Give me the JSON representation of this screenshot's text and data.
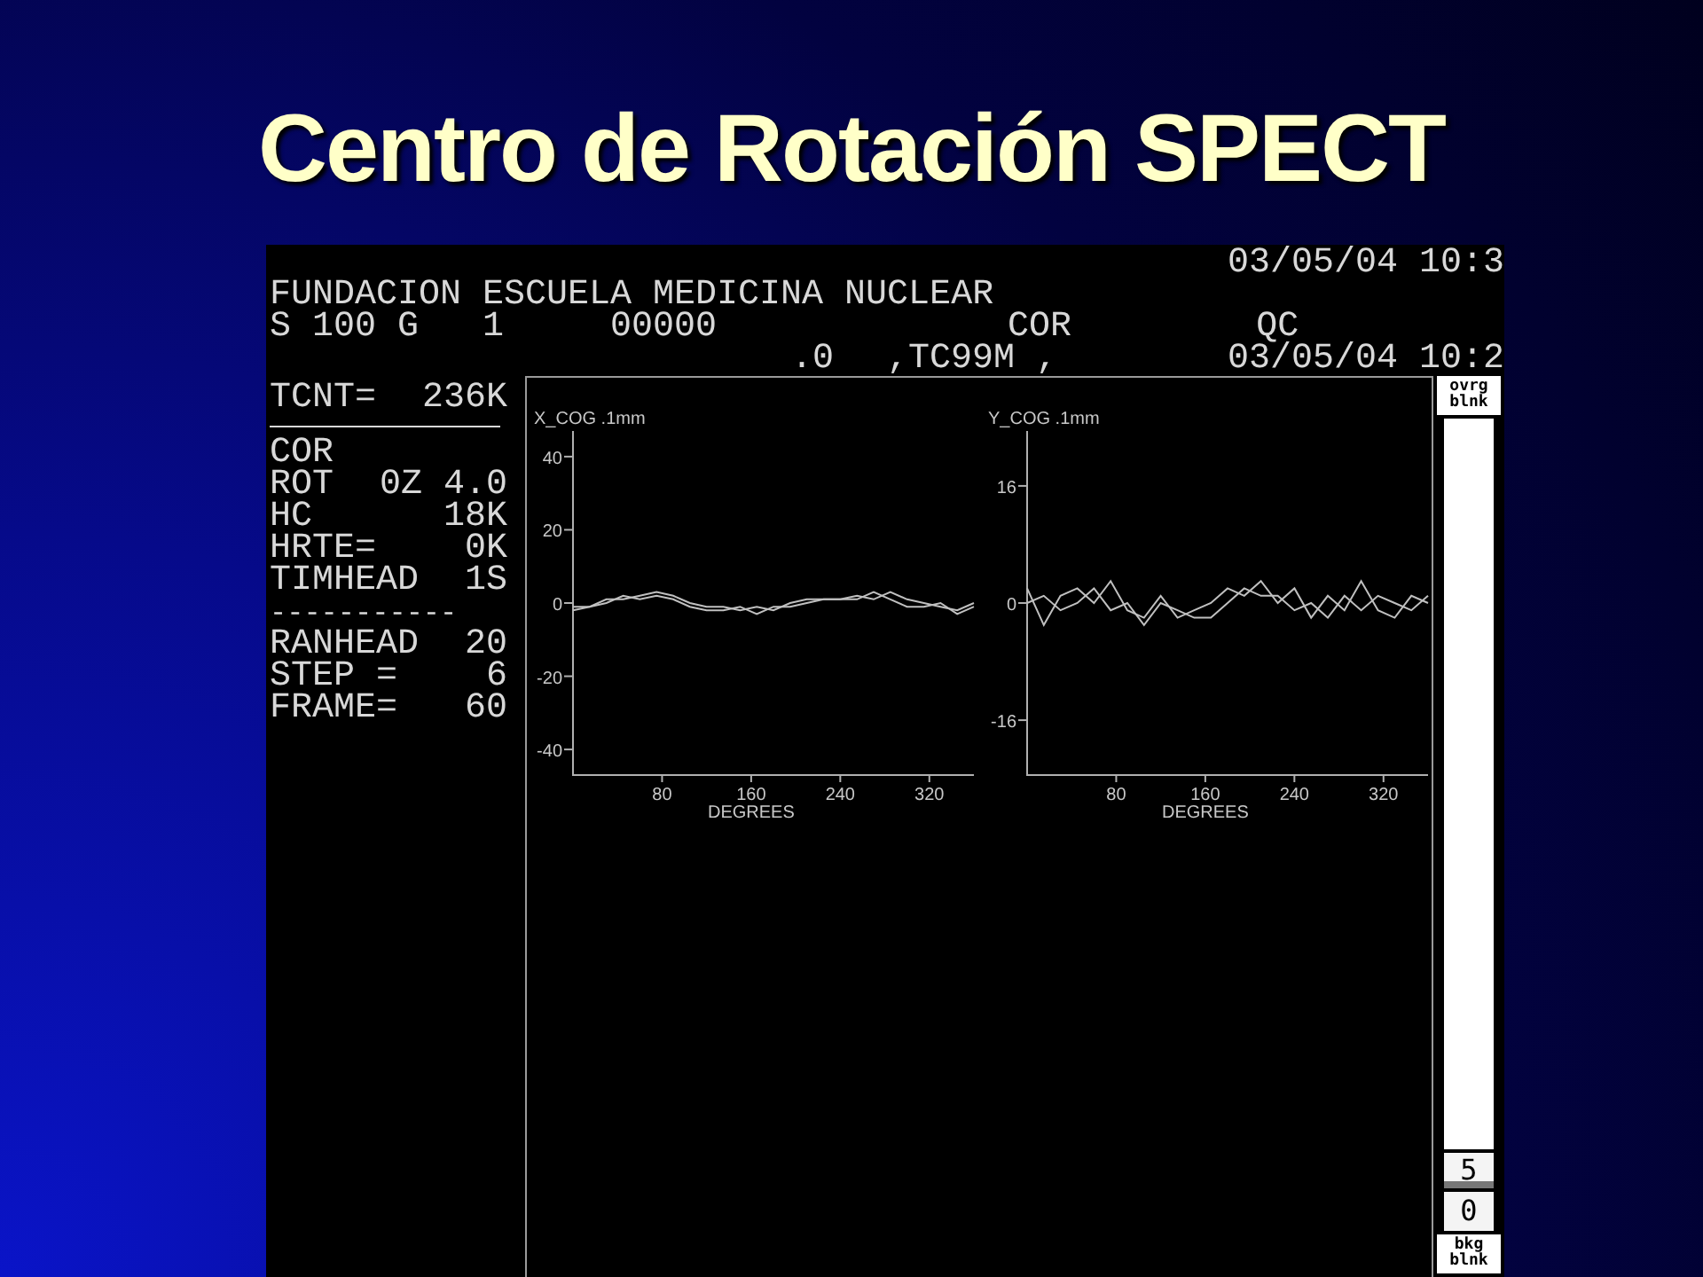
{
  "slide": {
    "title": "Centro de Rotación SPECT"
  },
  "screen": {
    "timestamp_top": "03/05/04 10:3",
    "institution": "FUNDACION ESCUELA MEDICINA NUCLEAR",
    "row_1": [
      "S 100 G   1",
      "00000",
      "COR",
      "QC"
    ],
    "row_2": [
      ".0",
      ",TC99M ,"
    ],
    "timestamp_acquisition": "03/05/04 10:2",
    "parameters": [
      {
        "kind": "field",
        "label": "TCNT=",
        "value": "236K"
      },
      {
        "kind": "rule"
      },
      {
        "kind": "field",
        "label": "COR"
      },
      {
        "kind": "field",
        "label": "ROT",
        "value": "0Z 4.0"
      },
      {
        "kind": "field",
        "label": "HC",
        "value": "18K"
      },
      {
        "kind": "field",
        "label": "HRTE=",
        "value": "0K"
      },
      {
        "kind": "field",
        "label": "TIMHEAD",
        "value": "1S"
      },
      {
        "kind": "dashes",
        "label": "-----------"
      },
      {
        "kind": "field",
        "label": "RANHEAD",
        "value": "20"
      },
      {
        "kind": "field",
        "label": "STEP =",
        "value": "6"
      },
      {
        "kind": "field",
        "label": "FRAME=",
        "value": "60"
      }
    ],
    "plots": [
      {
        "chart_data": {
          "type": "line",
          "title": "X_COG .1mm",
          "xlabel": "DEGREES",
          "x": [
            0,
            15,
            30,
            45,
            60,
            75,
            90,
            105,
            120,
            135,
            150,
            165,
            180,
            195,
            210,
            225,
            240,
            255,
            270,
            285,
            300,
            315,
            330,
            345,
            360
          ],
          "series": [
            {
              "color": "#c0c0c0",
              "values": [
                -1,
                -1,
                1,
                1,
                2,
                3,
                2,
                0,
                -1,
                -1,
                -2,
                -1,
                -2,
                0,
                1,
                1,
                1,
                2,
                1,
                3,
                1,
                0,
                -1,
                -2,
                0
              ]
            },
            {
              "color": "#c0c0c0",
              "values": [
                -2,
                -1,
                0,
                2,
                1,
                2,
                1,
                -1,
                -2,
                -2,
                -1,
                -3,
                -1,
                -1,
                0,
                1,
                1,
                1,
                3,
                1,
                -1,
                -1,
                0,
                -3,
                -1
              ]
            }
          ],
          "xlim": [
            0,
            360
          ],
          "ylim": [
            -47,
            47
          ],
          "xticks": [
            80,
            160,
            240,
            320
          ],
          "yticks": [
            -40,
            -20,
            0,
            20,
            40
          ]
        }
      },
      {
        "chart_data": {
          "type": "line",
          "title": "Y_COG .1mm",
          "xlabel": "DEGREES",
          "x": [
            0,
            15,
            30,
            45,
            60,
            75,
            90,
            105,
            120,
            135,
            150,
            165,
            180,
            195,
            210,
            225,
            240,
            255,
            270,
            285,
            300,
            315,
            330,
            345,
            360
          ],
          "series": [
            {
              "color": "#c0c0c0",
              "values": [
                2,
                -3,
                1,
                2,
                0,
                3,
                -1,
                -2,
                1,
                -2,
                -1,
                0,
                2,
                1,
                3,
                0,
                2,
                -2,
                1,
                -1,
                3,
                -1,
                -2,
                1,
                0
              ]
            },
            {
              "color": "#c0c0c0",
              "values": [
                0,
                1,
                -1,
                0,
                2,
                -1,
                0,
                -3,
                0,
                -1,
                -2,
                -2,
                0,
                2,
                1,
                1,
                -1,
                0,
                -2,
                1,
                -1,
                1,
                0,
                -1,
                1
              ]
            }
          ],
          "xlim": [
            0,
            360
          ],
          "ylim": [
            -23.5,
            23.5
          ],
          "xticks": [
            80,
            160,
            240,
            320
          ],
          "yticks": [
            -16,
            0,
            16
          ]
        }
      }
    ],
    "scale": {
      "top_label": [
        "ovrg",
        "blnk"
      ],
      "upper": "5",
      "lower": "0",
      "bottom_label": [
        "bkg",
        "blnk"
      ]
    }
  }
}
